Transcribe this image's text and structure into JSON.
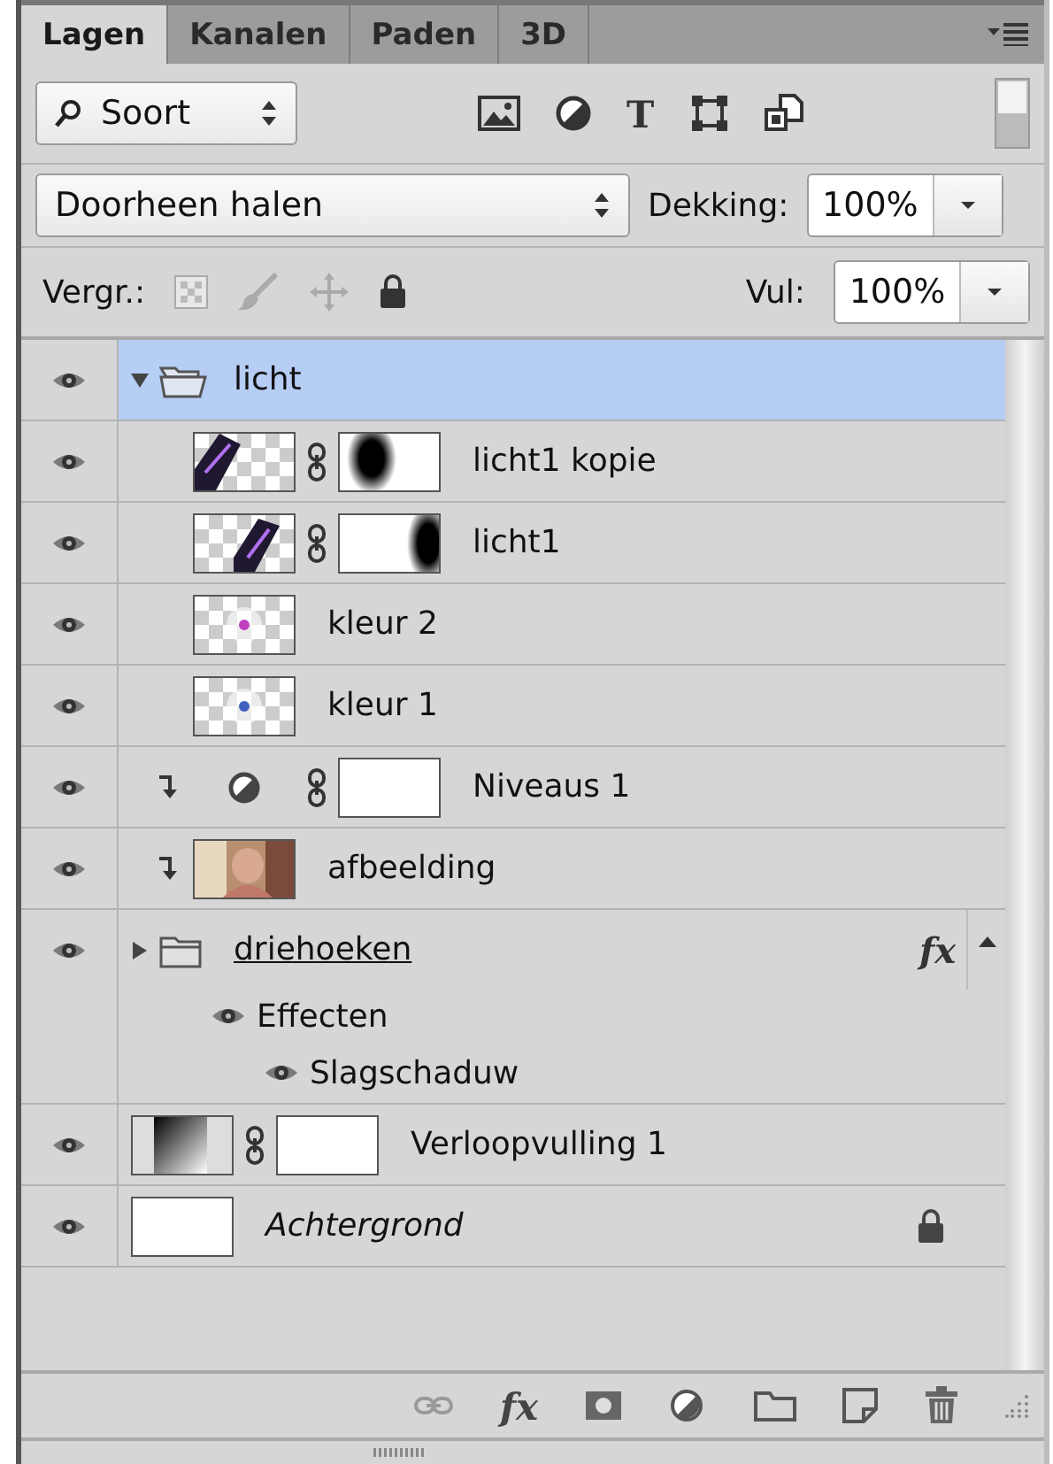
{
  "tabs": [
    {
      "label": "Lagen",
      "selected": true
    },
    {
      "label": "Kanalen",
      "selected": false
    },
    {
      "label": "Paden",
      "selected": false
    },
    {
      "label": "3D",
      "selected": false
    }
  ],
  "filter": {
    "value": "Soort",
    "type_glyph": "T"
  },
  "blend_mode": {
    "value": "Doorheen halen"
  },
  "opacity": {
    "label": "Dekking:",
    "value": "100%"
  },
  "lock": {
    "label": "Vergr.:"
  },
  "fill": {
    "label": "Vul:",
    "value": "100%"
  },
  "layers": [
    {
      "name": "licht",
      "kind": "group",
      "visible": true,
      "selected": true,
      "expanded": true,
      "children": [
        {
          "name": "licht1 kopie",
          "kind": "pixel",
          "thumbnail": {
            "kind": "streak-left"
          },
          "mask": {
            "kind": "dark-left"
          },
          "visible": true,
          "selected": false,
          "clipped": false
        },
        {
          "name": "licht1",
          "kind": "pixel",
          "thumbnail": {
            "kind": "streak-right"
          },
          "mask": {
            "kind": "dark-right"
          },
          "visible": true,
          "selected": false,
          "clipped": false
        },
        {
          "name": "kleur 2",
          "kind": "pixel",
          "thumbnail": {
            "kind": "glow",
            "color": "#c040c0"
          },
          "visible": true,
          "selected": false,
          "clipped": false
        },
        {
          "name": "kleur 1",
          "kind": "pixel",
          "thumbnail": {
            "kind": "glow",
            "color": "#4060c0"
          },
          "visible": true,
          "selected": false,
          "clipped": false
        },
        {
          "name": "Niveaus 1",
          "kind": "adjustment",
          "mask": {
            "kind": "blank"
          },
          "visible": true,
          "selected": false,
          "clipped": true
        },
        {
          "name": "afbeelding",
          "kind": "pixel",
          "visible": true,
          "selected": false,
          "clipped": true
        }
      ]
    },
    {
      "name": "driehoeken",
      "kind": "group",
      "visible": true,
      "selected": false,
      "expanded": false,
      "underlined": true,
      "fx": "fx",
      "effects": {
        "label": "Effecten",
        "visible": true,
        "items": [
          {
            "name": "Slagschaduw",
            "visible": true
          }
        ]
      }
    },
    {
      "name": "Verloopvulling 1",
      "kind": "pixel",
      "thumbnail": {
        "kind": "gradient"
      },
      "mask": {
        "kind": "blank"
      },
      "visible": true,
      "selected": false
    },
    {
      "name": "Achtergrond",
      "kind": "background",
      "thumbnail": {
        "kind": "blank"
      },
      "visible": true,
      "selected": false,
      "locked": true
    }
  ],
  "footer": {
    "fx": "fx"
  }
}
